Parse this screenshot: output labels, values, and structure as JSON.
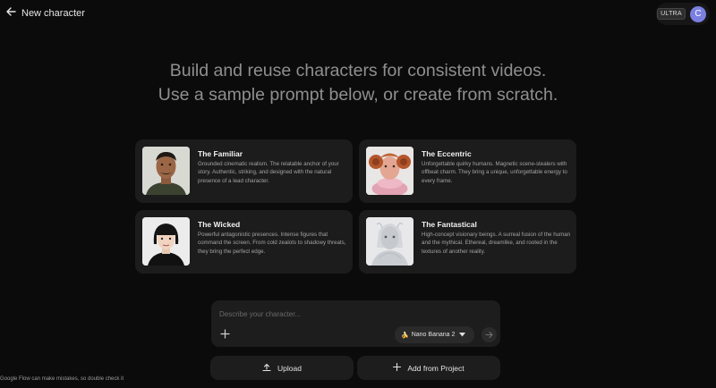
{
  "header": {
    "title": "New character",
    "tier_badge": "ULTRA",
    "avatar_initial": "C"
  },
  "headline": {
    "line1": "Build and reuse characters for consistent videos.",
    "line2": "Use a sample prompt below, or create from scratch."
  },
  "cards": [
    {
      "title": "The Familiar",
      "description": "Grounded cinematic realism. The relatable anchor of your story. Authentic, striking, and designed with the natural presence of a lead character."
    },
    {
      "title": "The Eccentric",
      "description": "Unforgettable quirky humans. Magnetic scene-stealers with offbeat charm. They bring a unique, unforgettable energy to every frame."
    },
    {
      "title": "The Wicked",
      "description": "Powerful antagonistic presences. Intense figures that command the screen. From cold zealots to shadowy threats, they bring the perfect edge."
    },
    {
      "title": "The Fantastical",
      "description": "High-concept visionary beings. A surreal fusion of the human and the mythical. Ethereal, dreamlike, and rooted in the textures of another reality."
    }
  ],
  "prompt": {
    "placeholder": "Describe your character...",
    "value": "",
    "model_emoji": "🍌",
    "model_label": "Nano Banana 2"
  },
  "actions": {
    "upload_label": "Upload",
    "add_from_project_label": "Add from Project"
  },
  "footer": {
    "note": "Google Flow can make mistakes, so double check it"
  },
  "icons": {
    "back": "arrow-left-icon",
    "plus": "plus-icon",
    "caret": "caret-down-icon",
    "send": "arrow-right-icon",
    "upload": "upload-icon",
    "add": "plus-icon"
  },
  "colors": {
    "background": "#0b0b0b",
    "card": "#1c1c1c",
    "avatar": "#7b7fe0"
  }
}
